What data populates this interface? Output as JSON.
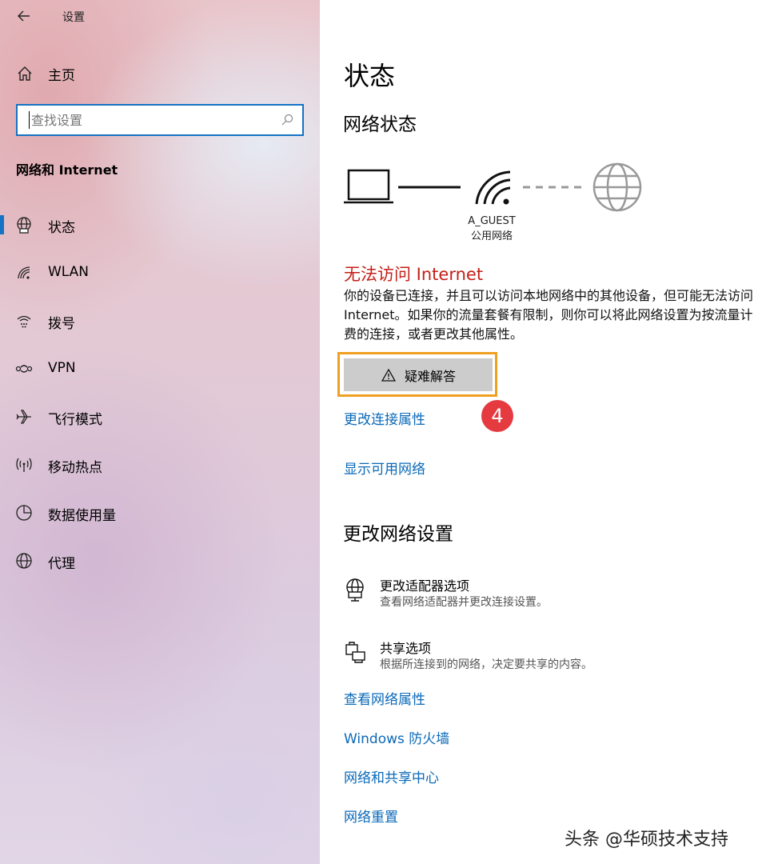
{
  "window": {
    "title": "设置"
  },
  "sidebar": {
    "home_label": "主页",
    "search_placeholder": "查找设置",
    "section_title": "网络和 Internet",
    "items": [
      {
        "label": "状态",
        "icon": "globe-network-icon",
        "selected": true
      },
      {
        "label": "WLAN",
        "icon": "wifi-icon",
        "selected": false
      },
      {
        "label": "拨号",
        "icon": "dialup-icon",
        "selected": false
      },
      {
        "label": "VPN",
        "icon": "vpn-icon",
        "selected": false
      },
      {
        "label": "飞行模式",
        "icon": "airplane-icon",
        "selected": false
      },
      {
        "label": "移动热点",
        "icon": "hotspot-icon",
        "selected": false
      },
      {
        "label": "数据使用量",
        "icon": "data-usage-icon",
        "selected": false
      },
      {
        "label": "代理",
        "icon": "globe-icon",
        "selected": false
      }
    ]
  },
  "main": {
    "title": "状态",
    "network_status_heading": "网络状态",
    "network": {
      "name": "A_GUEST",
      "type": "公用网络"
    },
    "error_title": "无法访问 Internet",
    "description": "你的设备已连接，并且可以访问本地网络中的其他设备，但可能无法访问 Internet。如果你的流量套餐有限制，则你可以将此网络设置为按流量计费的连接，或者更改其他属性。",
    "troubleshoot_label": "疑难解答",
    "step_badge": "4",
    "links": {
      "change_connection_properties": "更改连接属性",
      "show_available_networks": "显示可用网络"
    },
    "change_settings_heading": "更改网络设置",
    "options": [
      {
        "title": "更改适配器选项",
        "subtitle": "查看网络适配器并更改连接设置。",
        "icon": "adapter-icon"
      },
      {
        "title": "共享选项",
        "subtitle": "根据所连接到的网络，决定要共享的内容。",
        "icon": "sharing-icon"
      }
    ],
    "bottom_links": {
      "view_properties": "查看网络属性",
      "firewall": "Windows 防火墙",
      "sharing_center": "网络和共享中心",
      "reset": "网络重置"
    }
  },
  "watermark": "头条 @华硕技术支持",
  "colors": {
    "accent": "#1473c4",
    "link": "#0a69b8",
    "error": "#c41f18",
    "highlight": "#f0a020",
    "badge": "#e53a3f"
  }
}
